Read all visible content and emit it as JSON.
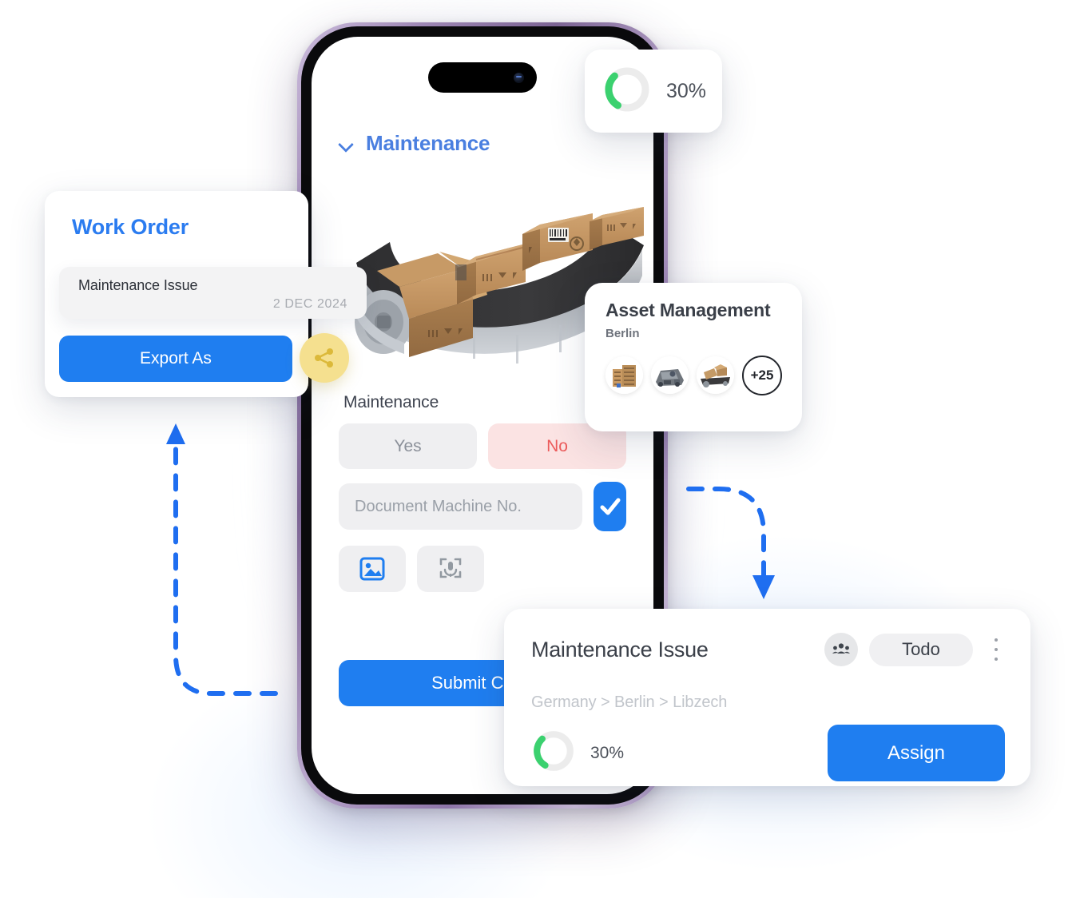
{
  "phone_app": {
    "section_header": "Maintenance",
    "chevron_icon": "chevron-down-icon",
    "hero_image_alt": "cardboard-boxes-on-conveyor-belt",
    "field_label": "Maintenance",
    "option_yes": "Yes",
    "option_no": "No",
    "machine_input_placeholder": "Document Machine No.",
    "machine_input_value": "",
    "confirm_icon": "checkmark-icon",
    "attach_image_icon": "image-icon",
    "attach_voice_icon": "voice-recorder-icon",
    "submit_label": "Submit Checklist"
  },
  "progress_card": {
    "percent_label": "30%",
    "percent_value": 30,
    "track_color": "#ececec",
    "fill_color": "#3bd16f"
  },
  "work_order_card": {
    "title": "Work Order",
    "chip_title": "Maintenance Issue",
    "chip_date": "2 DEC 2024",
    "export_label": "Export As",
    "share_icon": "share-icon",
    "accent_color": "#1f7ef0",
    "share_bg_color": "#f5e08f"
  },
  "asset_card": {
    "title": "Asset Management",
    "subtitle": "Berlin",
    "avatars": [
      "building-thumbnail",
      "machinery-thumbnail",
      "conveyor-boxes-thumbnail"
    ],
    "more_count": "+25"
  },
  "maintenance_issue_card": {
    "title": "Maintenance Issue",
    "people_icon": "people-group-icon",
    "status_label": "Todo",
    "menu_icon": "kebab-menu-icon",
    "breadcrumb": "Germany > Berlin > Libzech",
    "percent_label": "30%",
    "percent_value": 30,
    "assign_label": "Assign"
  },
  "arrows": {
    "left_arrow": "dashed-arrow-up",
    "right_arrow": "dashed-arrow-down",
    "color": "#1f6ef0"
  }
}
